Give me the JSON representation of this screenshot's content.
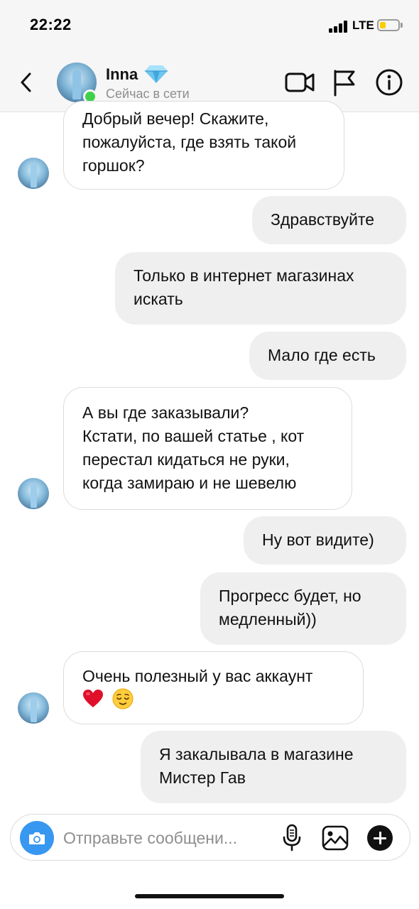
{
  "status_bar": {
    "time": "22:22",
    "network": "LTE"
  },
  "header": {
    "contact_name": "Inna",
    "contact_status": "Сейчас в сети",
    "icons": [
      "back-icon",
      "diamond-icon",
      "video-call-icon",
      "flag-icon",
      "info-icon"
    ]
  },
  "messages": [
    {
      "direction": "incoming",
      "lines": [
        "Добрый вечер! Скажите,",
        "пожалуйста, где взять такой",
        "горшок?"
      ]
    },
    {
      "direction": "outgoing",
      "lines": [
        "Здравствуйте"
      ]
    },
    {
      "direction": "outgoing",
      "lines": [
        "Только в интернет магазинах",
        "искать"
      ]
    },
    {
      "direction": "outgoing",
      "lines": [
        "Мало где есть"
      ]
    },
    {
      "direction": "incoming",
      "lines": [
        "А вы где заказывали?",
        "Кстати, по вашей статье , кот",
        "перестал кидаться не руки,",
        "когда замираю и не шевелю"
      ]
    },
    {
      "direction": "outgoing",
      "lines": [
        "Ну вот видите)"
      ]
    },
    {
      "direction": "outgoing",
      "lines": [
        "Прогресс будет, но",
        "медленный))"
      ]
    },
    {
      "direction": "incoming",
      "lines": [
        "Очень полезный у вас аккаунт"
      ],
      "emojis": [
        "red-heart",
        "relieved-face"
      ]
    },
    {
      "direction": "outgoing",
      "lines": [
        "Я закалывала в магазине",
        "Мистер Гав"
      ]
    }
  ],
  "composer": {
    "placeholder": "Отправьте сообщени...",
    "icons": [
      "camera-icon",
      "microphone-icon",
      "gallery-icon",
      "plus-icon"
    ]
  }
}
